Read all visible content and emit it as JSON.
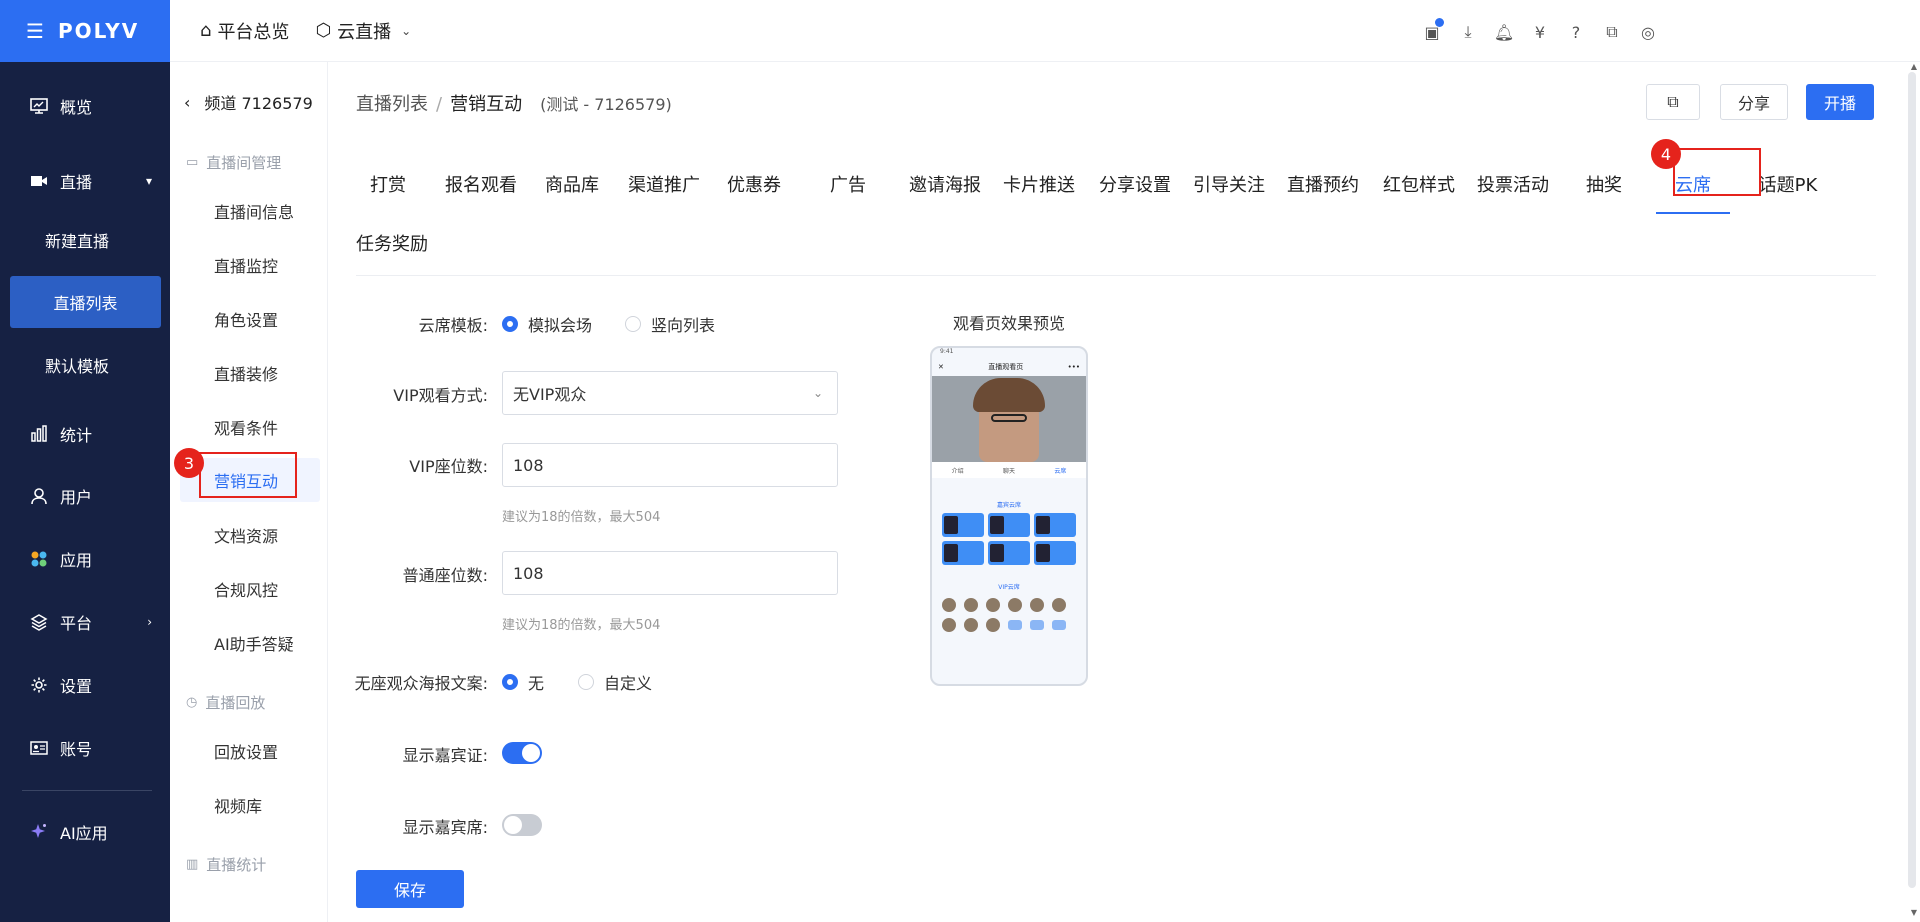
{
  "brand": {
    "logo": "POLYV",
    "menu_icon": "menu-icon"
  },
  "leftnav": {
    "items": [
      {
        "label": "概览",
        "icon": "monitor-icon"
      },
      {
        "label": "直播",
        "icon": "video-camera-icon"
      },
      {
        "label": "统计",
        "icon": "bar-chart-icon"
      },
      {
        "label": "用户",
        "icon": "user-icon"
      },
      {
        "label": "应用",
        "icon": "apps-icon"
      },
      {
        "label": "平台",
        "icon": "layers-icon"
      },
      {
        "label": "设置",
        "icon": "gear-icon"
      },
      {
        "label": "账号",
        "icon": "id-card-icon"
      },
      {
        "label": "AI应用",
        "icon": "sparkle-icon"
      }
    ],
    "live_sub": [
      "新建直播",
      "直播列表",
      "默认模板"
    ]
  },
  "topbar": {
    "home_label": "平台总览",
    "product_label": "云直播",
    "icons": [
      "clipboard-check-icon",
      "download-icon",
      "bell-icon",
      "yen-icon",
      "help-icon",
      "code-window-icon",
      "globe-icon"
    ]
  },
  "subnav": {
    "back_label": "频道 7126579",
    "groups": [
      {
        "title": "直播间管理",
        "items": [
          "直播间信息",
          "直播监控",
          "角色设置",
          "直播装修",
          "观看条件",
          "营销互动",
          "文档资源",
          "合规风控",
          "AI助手答疑"
        ]
      },
      {
        "title": "直播回放",
        "items": [
          "回放设置",
          "视频库"
        ]
      },
      {
        "title": "直播统计",
        "items": []
      }
    ],
    "active_item": "营销互动"
  },
  "breadcrumb": {
    "parent": "直播列表",
    "sep": "/",
    "current": "营销互动",
    "sub": "(测试 - 7126579)"
  },
  "header_buttons": {
    "share": "分享",
    "start": "开播"
  },
  "tabs": [
    "打赏",
    "报名观看",
    "商品库",
    "渠道推广",
    "优惠券",
    "广告",
    "邀请海报",
    "卡片推送",
    "分享设置",
    "引导关注",
    "直播预约",
    "红包样式",
    "投票活动",
    "抽奖",
    "云席",
    "话题PK"
  ],
  "tabs_row2": [
    "任务奖励"
  ],
  "active_tab": "云席",
  "annotations": {
    "badge3": "3",
    "badge4": "4"
  },
  "form": {
    "template": {
      "label": "云席模板:",
      "options": [
        "模拟会场",
        "竖向列表"
      ],
      "selected": "模拟会场"
    },
    "vip_mode": {
      "label": "VIP观看方式:",
      "value": "无VIP观众"
    },
    "vip_seats": {
      "label": "VIP座位数:",
      "value": "108",
      "hint": "建议为18的倍数，最大504"
    },
    "normal_seats": {
      "label": "普通座位数:",
      "value": "108",
      "hint": "建议为18的倍数，最大504"
    },
    "poster_text": {
      "label": "无座观众海报文案:",
      "options": [
        "无",
        "自定义"
      ],
      "selected": "无"
    },
    "show_guest_cert": {
      "label": "显示嘉宾证:",
      "on": true
    },
    "show_guest_seat": {
      "label": "显示嘉宾席:",
      "on": false
    },
    "save_label": "保存"
  },
  "preview": {
    "title": "观看页效果预览",
    "phone_title": "直播观看页",
    "status_time": "9:41",
    "tabs": [
      "介绍",
      "聊天",
      "云席"
    ],
    "stage_title": "嘉宾云席",
    "vip_title": "VIP云席"
  },
  "colors": {
    "primary": "#2c6ef2",
    "nav_bg": "#162143",
    "annotation": "#e5231c"
  }
}
